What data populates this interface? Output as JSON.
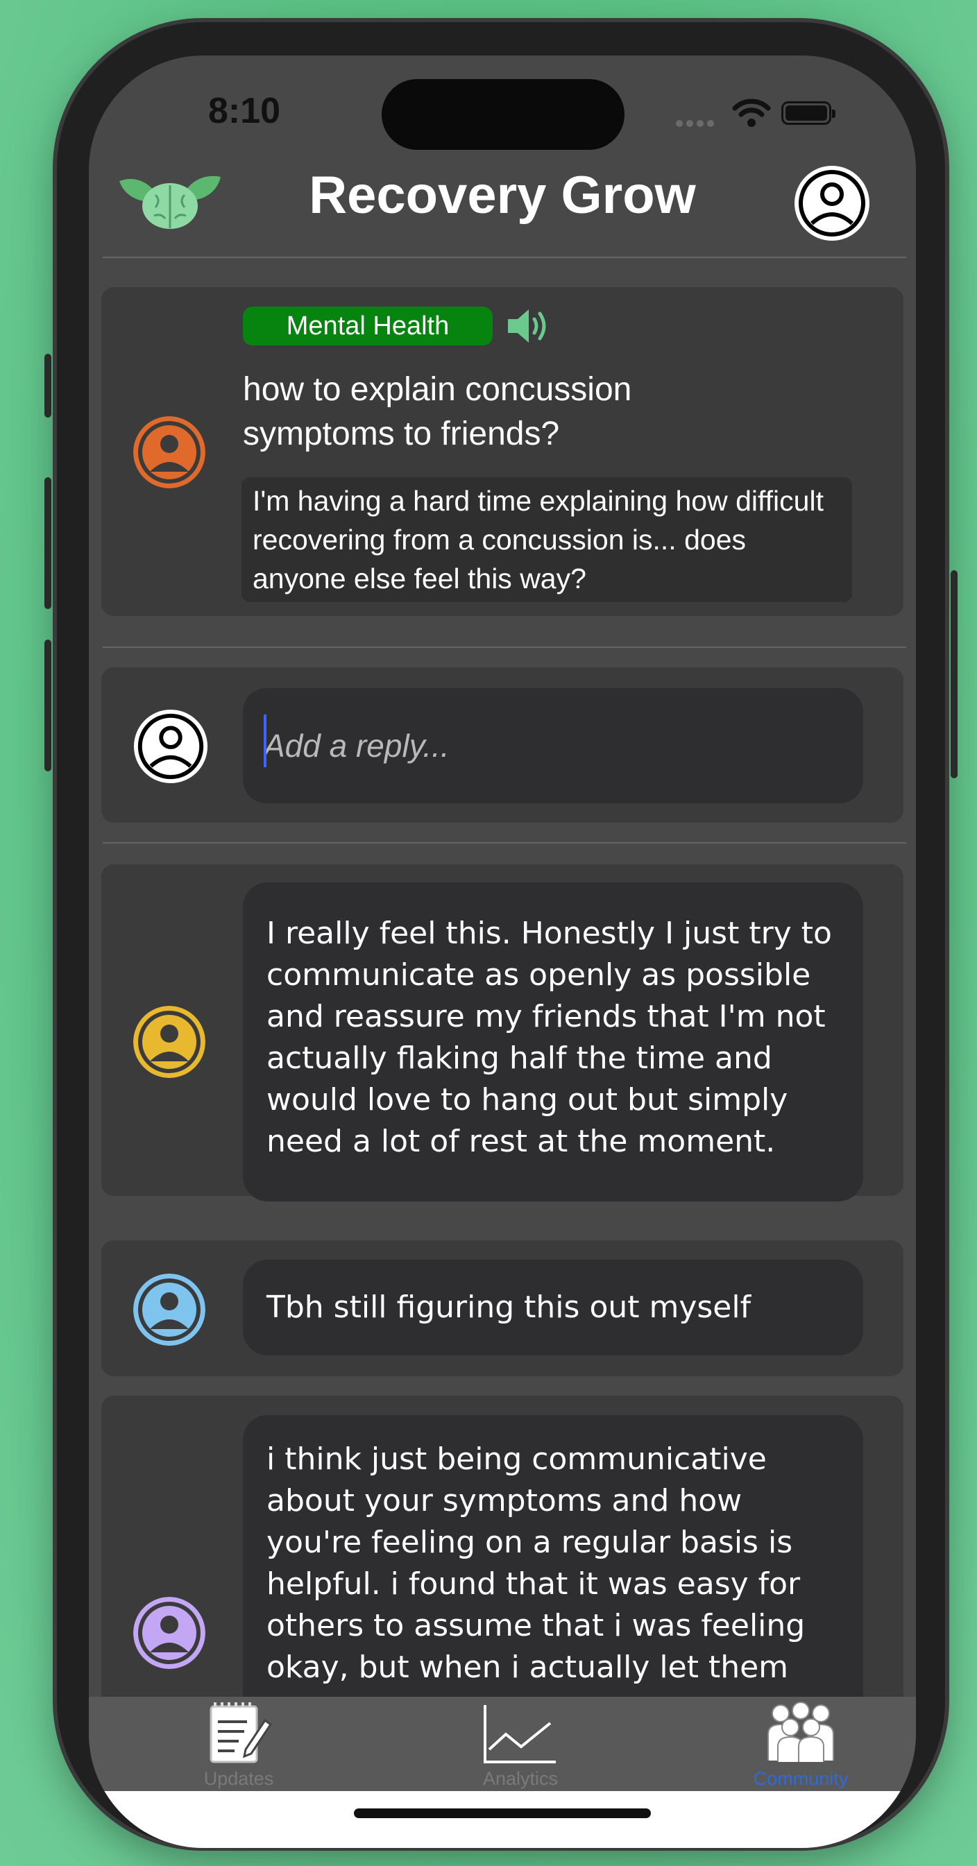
{
  "status_bar": {
    "time": "8:10"
  },
  "header": {
    "title": "Recovery Grow",
    "logo_icon": "brain-leaves-icon",
    "profile_icon": "user-circle-icon"
  },
  "post": {
    "tag": "Mental Health",
    "tag_color": "#07830f",
    "title": "how to explain concussion symptoms to friends?",
    "body": "I'm having a hard time explaining how difficult recovering from a concussion is... does anyone else feel this way?",
    "avatar_color": "#e06a2b"
  },
  "reply": {
    "placeholder": "Add a reply..."
  },
  "comments": [
    {
      "text": "I really feel this. Honestly I just try to communicate as openly as possible and reassure my friends that I'm not actually flaking half the time and would love to hang out but simply need a lot of rest at the moment.",
      "avatar_color": "#e8b92f"
    },
    {
      "text": "Tbh still figuring this out myself",
      "avatar_color": "#7fc4ee"
    },
    {
      "text": "i think just being communicative about your symptoms and how you're feeling on a regular basis is helpful. i found that it was easy for others to assume that i was feeling okay, but when i actually let them",
      "avatar_color": "#c3a6f4"
    }
  ],
  "tabs": [
    {
      "label": "Updates",
      "icon": "notepad-icon",
      "active": false
    },
    {
      "label": "Analytics",
      "icon": "line-chart-icon",
      "active": false
    },
    {
      "label": "Community",
      "icon": "people-group-icon",
      "active": true
    }
  ],
  "colors": {
    "accent": "#2f6bd8",
    "background": "#5cc286"
  }
}
